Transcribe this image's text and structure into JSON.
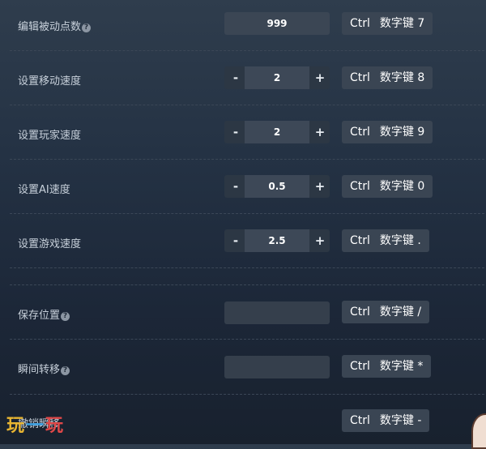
{
  "rows": [
    {
      "label": "编辑被动点数",
      "help": "?",
      "value": "999",
      "hotkey": {
        "ctrl": "Ctrl",
        "key": "数字键 7"
      }
    },
    {
      "label": "设置移动速度",
      "minus": "-",
      "value": "2",
      "plus": "+",
      "hotkey": {
        "ctrl": "Ctrl",
        "key": "数字键 8"
      }
    },
    {
      "label": "设置玩家速度",
      "minus": "-",
      "value": "2",
      "plus": "+",
      "hotkey": {
        "ctrl": "Ctrl",
        "key": "数字键 9"
      }
    },
    {
      "label": "设置AI速度",
      "minus": "-",
      "value": "0.5",
      "plus": "+",
      "hotkey": {
        "ctrl": "Ctrl",
        "key": "数字键 0"
      }
    },
    {
      "label": "设置游戏速度",
      "minus": "-",
      "value": "2.5",
      "plus": "+",
      "hotkey": {
        "ctrl": "Ctrl",
        "key": "数字键 ."
      }
    },
    {
      "label": "保存位置",
      "help": "?",
      "value": "",
      "hotkey": {
        "ctrl": "Ctrl",
        "key": "数字键 /"
      }
    },
    {
      "label": "瞬间转移",
      "help": "?",
      "value": "",
      "hotkey": {
        "ctrl": "Ctrl",
        "key": "数字键 *"
      }
    },
    {
      "label": "撤销瞬移",
      "hotkey": {
        "ctrl": "Ctrl",
        "key": "数字键 -"
      }
    }
  ],
  "watermark": {
    "part1": "玩",
    "part2": "一",
    "part3": "玩"
  }
}
